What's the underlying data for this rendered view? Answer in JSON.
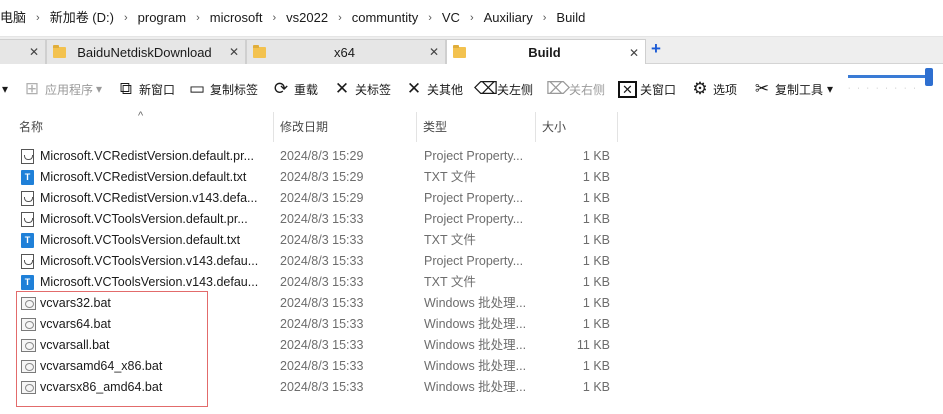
{
  "breadcrumb": [
    "电脑",
    "新加卷 (D:)",
    "program",
    "microsoft",
    "vs2022",
    "communtity",
    "VC",
    "Auxiliary",
    "Build"
  ],
  "breadcrumb_separator": "›",
  "tabs": [
    {
      "label": "",
      "close": "✕"
    },
    {
      "label": "BaiduNetdiskDownload",
      "close": "✕"
    },
    {
      "label": "x64",
      "close": "✕"
    },
    {
      "label": "Build",
      "close": "✕"
    }
  ],
  "new_tab_label": "+",
  "toolbar": {
    "dropdown_caret": "▾",
    "apps": "应用程序",
    "new_window": "新窗口",
    "copy_tabs": "复制标签",
    "reload": "重载",
    "close_tab": "关标签",
    "close_others": "关其他",
    "close_left": "关左侧",
    "close_right": "关右侧",
    "close_window": "关窗口",
    "options": "选项",
    "copy_tools": "复制工具"
  },
  "columns": {
    "name": "名称",
    "date": "修改日期",
    "type": "类型",
    "size": "大小",
    "sort_indicator": "^"
  },
  "files": [
    {
      "name": "Microsoft.VCRedistVersion.default.pr...",
      "date": "2024/8/3 15:29",
      "type": "Project Property...",
      "size": "1 KB",
      "kind": "prop"
    },
    {
      "name": "Microsoft.VCRedistVersion.default.txt",
      "date": "2024/8/3 15:29",
      "type": "TXT 文件",
      "size": "1 KB",
      "kind": "txt"
    },
    {
      "name": "Microsoft.VCRedistVersion.v143.defa...",
      "date": "2024/8/3 15:29",
      "type": "Project Property...",
      "size": "1 KB",
      "kind": "prop"
    },
    {
      "name": "Microsoft.VCToolsVersion.default.pr...",
      "date": "2024/8/3 15:33",
      "type": "Project Property...",
      "size": "1 KB",
      "kind": "prop"
    },
    {
      "name": "Microsoft.VCToolsVersion.default.txt",
      "date": "2024/8/3 15:33",
      "type": "TXT 文件",
      "size": "1 KB",
      "kind": "txt"
    },
    {
      "name": "Microsoft.VCToolsVersion.v143.defau...",
      "date": "2024/8/3 15:33",
      "type": "Project Property...",
      "size": "1 KB",
      "kind": "prop"
    },
    {
      "name": "Microsoft.VCToolsVersion.v143.defau...",
      "date": "2024/8/3 15:33",
      "type": "TXT 文件",
      "size": "1 KB",
      "kind": "txt"
    },
    {
      "name": "vcvars32.bat",
      "date": "2024/8/3 15:33",
      "type": "Windows 批处理...",
      "size": "1 KB",
      "kind": "bat"
    },
    {
      "name": "vcvars64.bat",
      "date": "2024/8/3 15:33",
      "type": "Windows 批处理...",
      "size": "1 KB",
      "kind": "bat"
    },
    {
      "name": "vcvarsall.bat",
      "date": "2024/8/3 15:33",
      "type": "Windows 批处理...",
      "size": "11 KB",
      "kind": "bat"
    },
    {
      "name": "vcvarsamd64_x86.bat",
      "date": "2024/8/3 15:33",
      "type": "Windows 批处理...",
      "size": "1 KB",
      "kind": "bat"
    },
    {
      "name": "vcvarsx86_amd64.bat",
      "date": "2024/8/3 15:33",
      "type": "Windows 批处理...",
      "size": "1 KB",
      "kind": "bat"
    }
  ],
  "zoom_level": 0.95,
  "colors": {
    "accent": "#2e6fd0",
    "folder": "#f3c24f",
    "highlight_border": "#e26b6b",
    "txt_icon": "#1f80d8"
  }
}
